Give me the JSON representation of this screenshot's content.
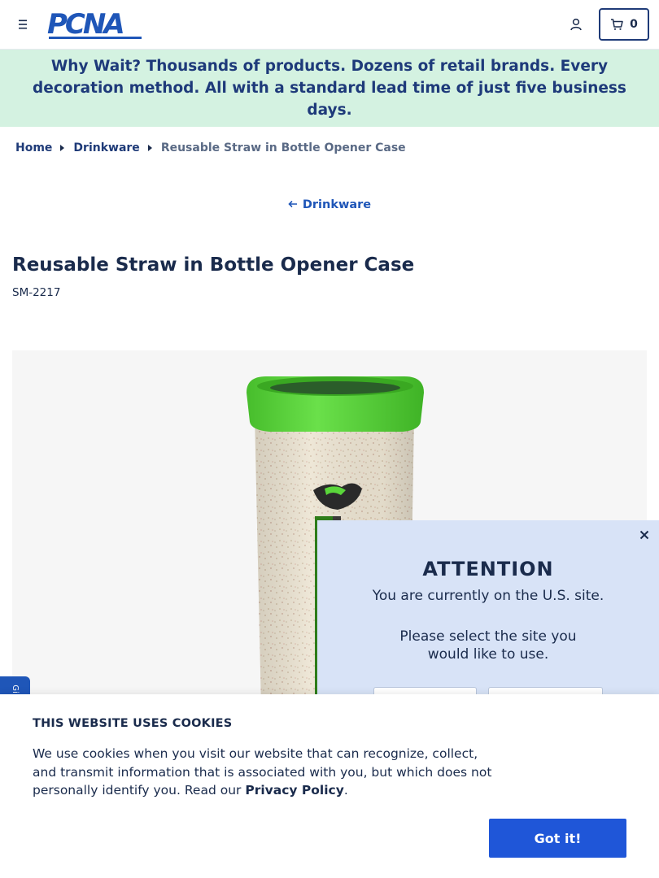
{
  "header": {
    "logo_text": "PCNA",
    "cart_count": "0"
  },
  "banner": {
    "lead": "Why Wait?",
    "text": " Thousands of products. Dozens of retail brands. Every decoration method. All with a standard lead time of just five business days."
  },
  "breadcrumb": {
    "items": [
      "Home",
      "Drinkware"
    ],
    "current": "Reusable Straw in Bottle Opener Case"
  },
  "back_link": {
    "label": "Drinkware"
  },
  "product": {
    "title": "Reusable Straw in Bottle Opener Case",
    "sku": "SM-2217"
  },
  "attention_modal": {
    "title": "ATTENTION",
    "subtitle": "You are currently on the U.S. site.",
    "prompt": "Please select the site you would like to use."
  },
  "side_tab": {
    "label": "Gi"
  },
  "cookie_banner": {
    "title": "THIS WEBSITE USES COOKIES",
    "text": "We use cookies when you visit our website that can recognize, collect, and transmit information that is associated with you, but which does not personally identify you. Read our ",
    "link": "Privacy Policy",
    "text_end": ".",
    "button": "Got it!"
  },
  "colors": {
    "brand_blue": "#1f56b8",
    "banner_bg": "#d4f2e1",
    "modal_bg": "#d8e3f7",
    "cookie_button": "#1f56d8",
    "cap_green": "#5ad63a"
  }
}
